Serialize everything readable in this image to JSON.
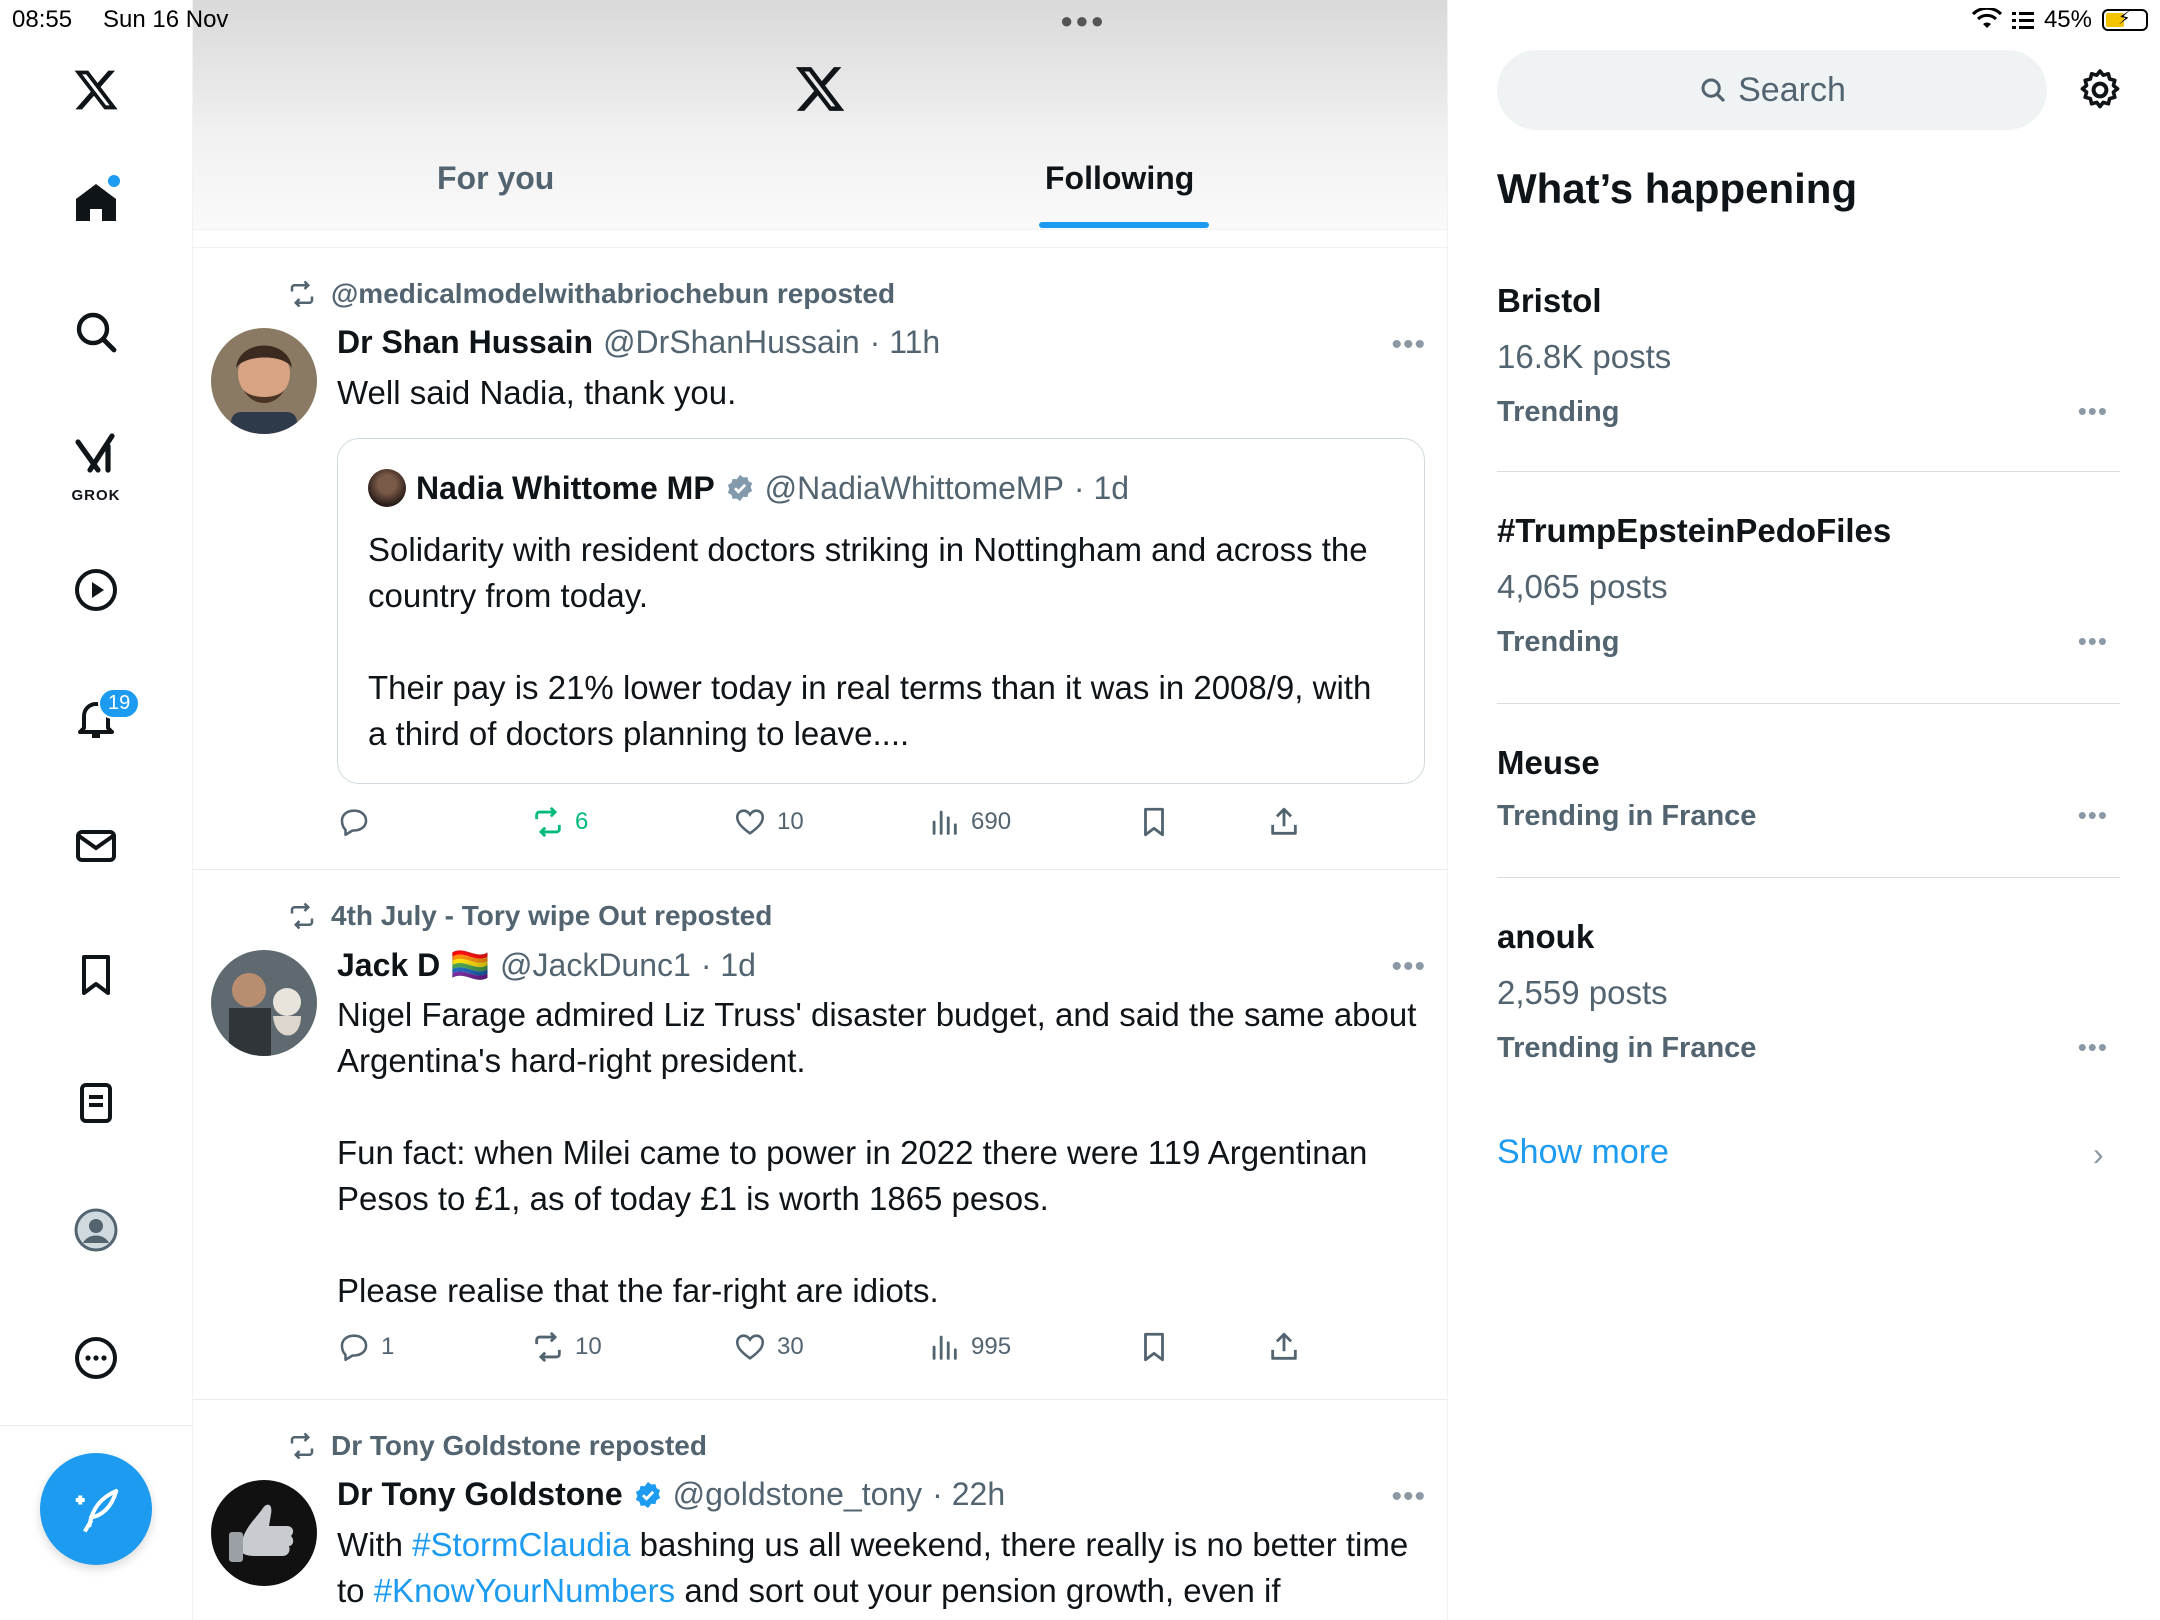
{
  "status_bar": {
    "time": "08:55",
    "date": "Sun 16 Nov",
    "battery": "45%"
  },
  "nav": {
    "grok_label": "GROK",
    "notifications_badge": "19"
  },
  "tabs": {
    "for_you": "For you",
    "following": "Following"
  },
  "posts": [
    {
      "repost_by": "@medicalmodelwithabriochebun reposted",
      "name": "Dr Shan Hussain",
      "handle": "@DrShanHussain",
      "time": "· 11h",
      "text": "Well said Nadia, thank you.",
      "quote": {
        "name": "Nadia Whittome MP",
        "handle": "@NadiaWhittomeMP",
        "time": "· 1d",
        "text": "Solidarity with resident doctors striking in Nottingham and across the country from today.\n\nTheir pay is 21% lower today in real terms than it was in 2008/9, with a third of doctors planning to leave...."
      },
      "stats": {
        "replies": "",
        "reposts": "6",
        "likes": "10",
        "views": "690"
      }
    },
    {
      "repost_by": "4th July - Tory wipe Out reposted",
      "name": "Jack D",
      "flag": "🏳️‍🌈",
      "handle": "@JackDunc1",
      "time": "· 1d",
      "text": "Nigel Farage admired Liz Truss' disaster budget, and said the same about Argentina's hard-right president.\n\nFun fact: when Milei came to power in 2022 there were 119 Argentinan Pesos to £1, as of today £1 is worth 1865 pesos.\n\nPlease realise that the far-right are idiots.",
      "stats": {
        "replies": "1",
        "reposts": "10",
        "likes": "30",
        "views": "995"
      }
    },
    {
      "repost_by": "Dr Tony Goldstone reposted",
      "name": "Dr Tony Goldstone",
      "handle": "@goldstone_tony",
      "time": "· 22h",
      "text_parts": [
        "With ",
        "#StormClaudia",
        " bashing us all weekend, there really is no better time to ",
        "#KnowYourNumbers",
        " and sort out your pension growth, even if"
      ]
    }
  ],
  "sidebar": {
    "search_placeholder": "Search",
    "title": "What’s happening",
    "trends": [
      {
        "name": "Bristol",
        "count": "16.8K posts",
        "context": "Trending"
      },
      {
        "name": "#TrumpEpsteinPedoFiles",
        "count": "4,065 posts",
        "context": "Trending"
      },
      {
        "name": "Meuse",
        "count": "",
        "context": "Trending in France"
      },
      {
        "name": "anouk",
        "count": "2,559 posts",
        "context": "Trending in France"
      }
    ],
    "show_more": "Show more"
  },
  "colors": {
    "accent": "#1d9bf0",
    "text": "#0f1419",
    "muted": "#536471",
    "repost_green": "#00ba7c"
  },
  "icons": [
    "x-logo-icon",
    "home-icon",
    "search-icon",
    "grok-icon",
    "video-icon",
    "bell-icon",
    "mail-icon",
    "bookmark-icon",
    "list-icon",
    "profile-icon",
    "more-icon",
    "compose-icon",
    "reply-icon",
    "repost-icon",
    "like-icon",
    "views-icon",
    "share-icon",
    "gear-icon",
    "verified-icon",
    "chevron-right-icon"
  ]
}
